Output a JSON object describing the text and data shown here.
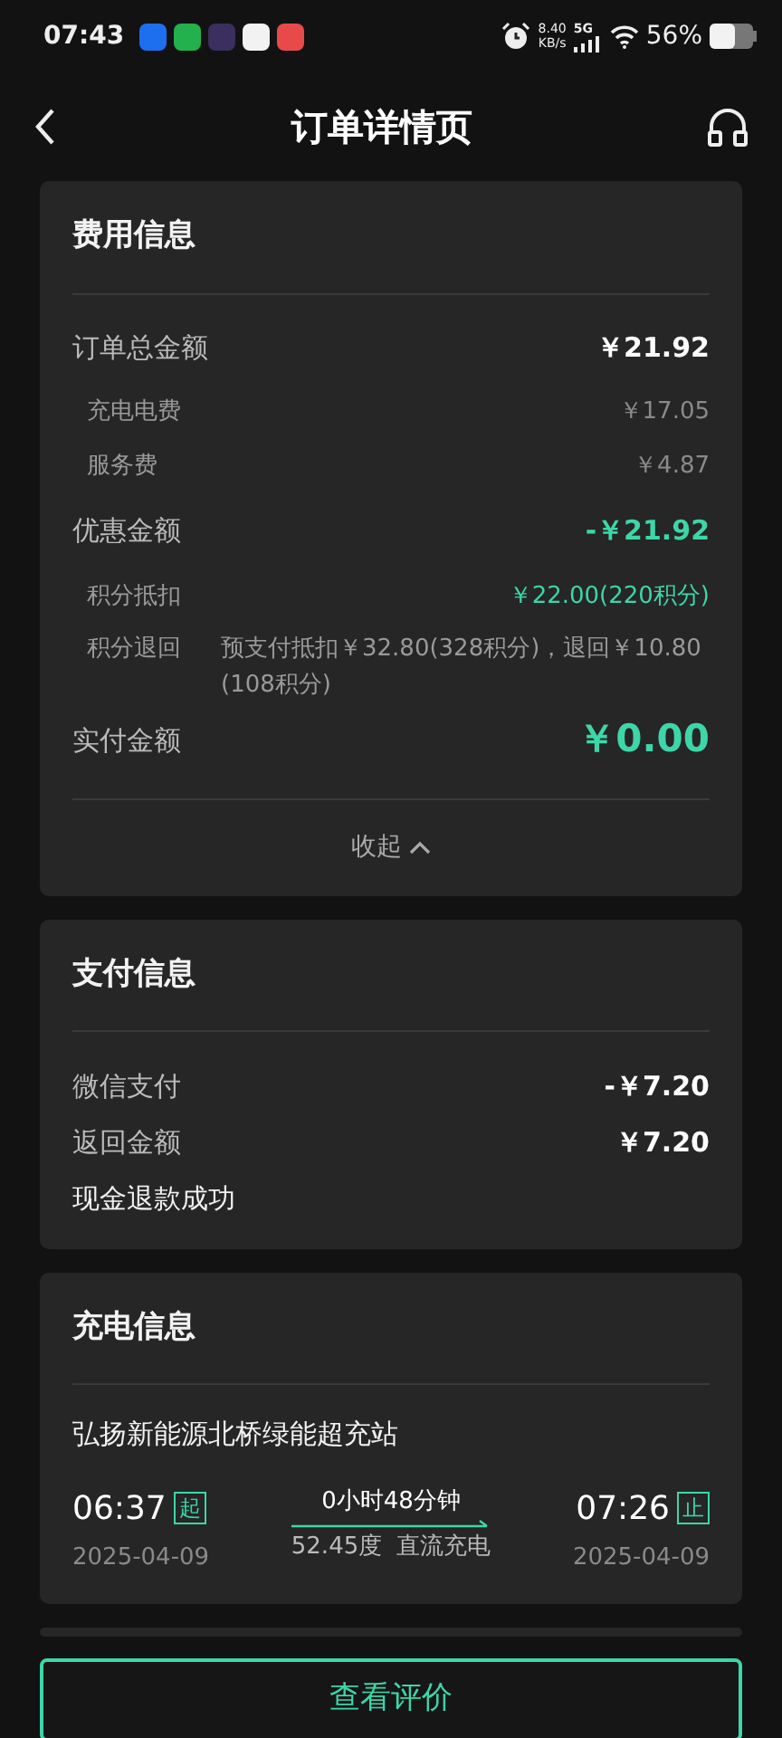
{
  "status_bar": {
    "time": "07:43",
    "net_speed": "8.40",
    "net_unit": "KB/s",
    "network": "5G",
    "battery": "56%",
    "app_icons": [
      {
        "color": "#1e6ff0"
      },
      {
        "color": "#22b14c"
      },
      {
        "color": "#3a2f5e"
      },
      {
        "color": "#f2f2f2"
      },
      {
        "color": "#e84a4a"
      }
    ]
  },
  "header": {
    "title": "订单详情页"
  },
  "fee_card": {
    "title": "费用信息",
    "rows": [
      {
        "kind": "main",
        "label": "订单总金额",
        "value": "￥21.92",
        "highlight": false
      },
      {
        "kind": "sub",
        "label": "充电电费",
        "value": "￥17.05",
        "highlight": false
      },
      {
        "kind": "sub",
        "label": "服务费",
        "value": "￥4.87",
        "highlight": false
      },
      {
        "kind": "main",
        "label": "优惠金额",
        "value": "-￥21.92",
        "highlight": true
      },
      {
        "kind": "sub",
        "label": "积分抵扣",
        "value": "￥22.00(220积分)",
        "highlight": true
      },
      {
        "kind": "note",
        "label": "积分退回",
        "value": "预支付抵扣￥32.80(328积分)，退回￥10.80(108积分)",
        "highlight": false
      },
      {
        "kind": "total",
        "label": "实付金额",
        "value": "￥0.00",
        "highlight": true
      }
    ],
    "collapse": {
      "label": "收起",
      "expanded": true
    }
  },
  "pay_card": {
    "title": "支付信息",
    "rows": [
      {
        "label": "微信支付",
        "value": "-￥7.20"
      },
      {
        "label": "返回金额",
        "value": "￥7.20"
      }
    ],
    "status": "现金退款成功"
  },
  "charge_card": {
    "title": "充电信息",
    "station": "弘扬新能源北桥绿能超充站",
    "start": {
      "time": "06:37",
      "tag": "起",
      "date": "2025-04-09"
    },
    "duration": "0小时48分钟",
    "energy": "52.45度",
    "mode": "直流充电",
    "end": {
      "time": "07:26",
      "tag": "止",
      "date": "2025-04-09"
    }
  },
  "action_button": {
    "label": "查看评价"
  }
}
